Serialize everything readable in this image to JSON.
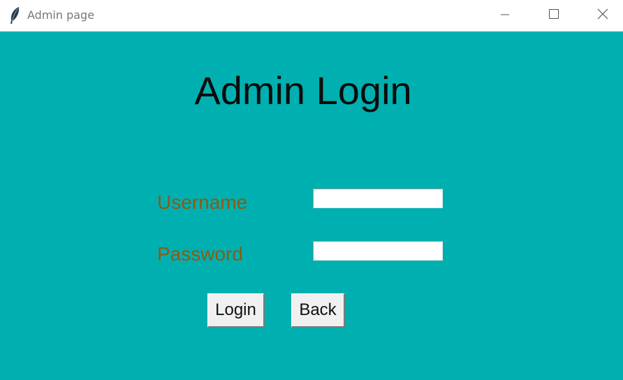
{
  "window": {
    "title": "Admin page",
    "icon": "feather-icon",
    "controls": [
      "minimize-icon",
      "maximize-icon",
      "close-icon"
    ]
  },
  "form": {
    "heading": "Admin Login",
    "username_label": "Username",
    "username_value": "",
    "password_label": "Password",
    "password_value": "",
    "login_label": "Login",
    "back_label": "Back"
  },
  "colors": {
    "background": "#00b0b0",
    "label": "#8c5a14",
    "heading": "#0c0c0c"
  }
}
